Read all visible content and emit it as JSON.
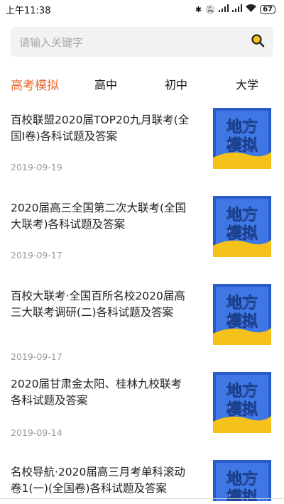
{
  "status": {
    "time": "上午11:38",
    "battery": "67"
  },
  "search": {
    "placeholder": "请输入关键字"
  },
  "tabs": [
    {
      "label": "高考模拟"
    },
    {
      "label": "高中"
    },
    {
      "label": "初中"
    },
    {
      "label": "大学"
    }
  ],
  "thumb": {
    "line1": "地方",
    "line2": "模拟",
    "colors": {
      "frame": "#2a5bc9",
      "panel": "#3f78e6",
      "accent": "#f5c21b"
    }
  },
  "articles": [
    {
      "title": "百校联盟2020届TOP20九月联考(全国I卷)各科试题及答案",
      "date": "2019-09-19"
    },
    {
      "title": "2020届高三全国第二次大联考(全国大联考)各科试题及答案",
      "date": "2019-09-17"
    },
    {
      "title": "百校大联考·全国百所名校2020届高三大联考调研(二)各科试题及答案",
      "date": "2019-09-17"
    },
    {
      "title": "2020届甘肃金太阳、桂林九校联考各科试题及答案",
      "date": "2019-09-14"
    },
    {
      "title": "名校导航·2020届高三月考单科滚动卷1(一)(全国卷)各科试题及答案",
      "date": ""
    }
  ]
}
